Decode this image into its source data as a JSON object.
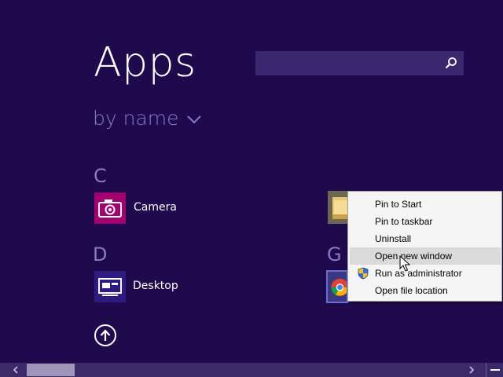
{
  "header": {
    "title": "Apps",
    "sort_label": "by name"
  },
  "search": {
    "value": "",
    "placeholder": ""
  },
  "groups": [
    {
      "letter": "C",
      "apps": [
        {
          "name": "Camera"
        }
      ]
    },
    {
      "letter": "D",
      "apps": [
        {
          "name": "Desktop"
        }
      ]
    },
    {
      "letter": "G",
      "apps": []
    }
  ],
  "context_menu": {
    "items": [
      {
        "label": "Pin to Start"
      },
      {
        "label": "Pin to taskbar"
      },
      {
        "label": "Uninstall"
      },
      {
        "label": "Open new window",
        "highlighted": true
      },
      {
        "label": "Run as administrator",
        "icon": "uac-shield-icon"
      },
      {
        "label": "Open file location"
      }
    ]
  },
  "colors": {
    "background": "#1e0a4c",
    "camera_tile": "#a3006f",
    "desktop_tile": "#2d1b82",
    "group_letter": "#8b79c8"
  },
  "icons": [
    "search-icon",
    "chevron-down-icon",
    "camera-icon",
    "desktop-icon",
    "file-explorer-icon",
    "chrome-icon",
    "arrow-up-icon",
    "uac-shield-icon",
    "mouse-cursor-icon",
    "scroll-left-icon",
    "scroll-right-icon",
    "semantic-zoom-icon"
  ]
}
